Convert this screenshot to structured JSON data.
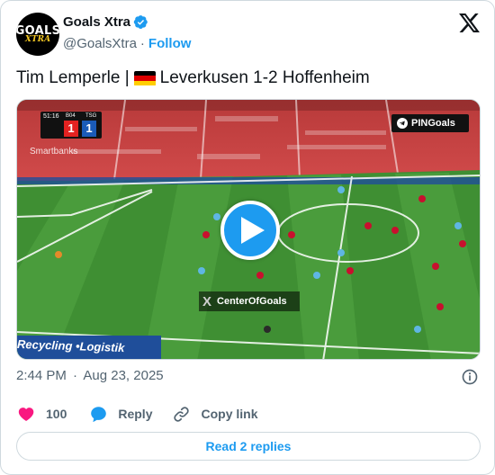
{
  "author": {
    "avatar_text_top": "GOALS",
    "avatar_text_bottom": "XTRA",
    "name": "Goals Xtra",
    "handle": "@GoalsXtra",
    "separator": "·",
    "follow_label": "Follow"
  },
  "tweet": {
    "text_before_flag": "Tim Lemperle |",
    "flag_colors": [
      "#000000",
      "#dd0000",
      "#ffce00"
    ],
    "text_after_flag": "Leverkusen 1-2 Hoffenheim"
  },
  "video": {
    "match_clock": "51:16",
    "home_abbr": "B04",
    "away_abbr": "TSG",
    "home_score": "1",
    "away_score": "1",
    "sponsor_text": "Smartbanks",
    "channel_badge": "PINGoals",
    "watermark": "CenterOfGoals",
    "ad_board_text": "Recycling •Logistik"
  },
  "meta": {
    "time": "2:44 PM",
    "separator": "·",
    "date": "Aug 23, 2025"
  },
  "actions": {
    "like_count": "100",
    "reply_label": "Reply",
    "copy_link_label": "Copy link",
    "like_color": "#f91880",
    "reply_color": "#1d9bf0"
  },
  "footer": {
    "read_replies_label": "Read 2 replies"
  },
  "colors": {
    "accent": "#1d9bf0",
    "secondary_text": "#536471",
    "border": "#cfd9de"
  }
}
